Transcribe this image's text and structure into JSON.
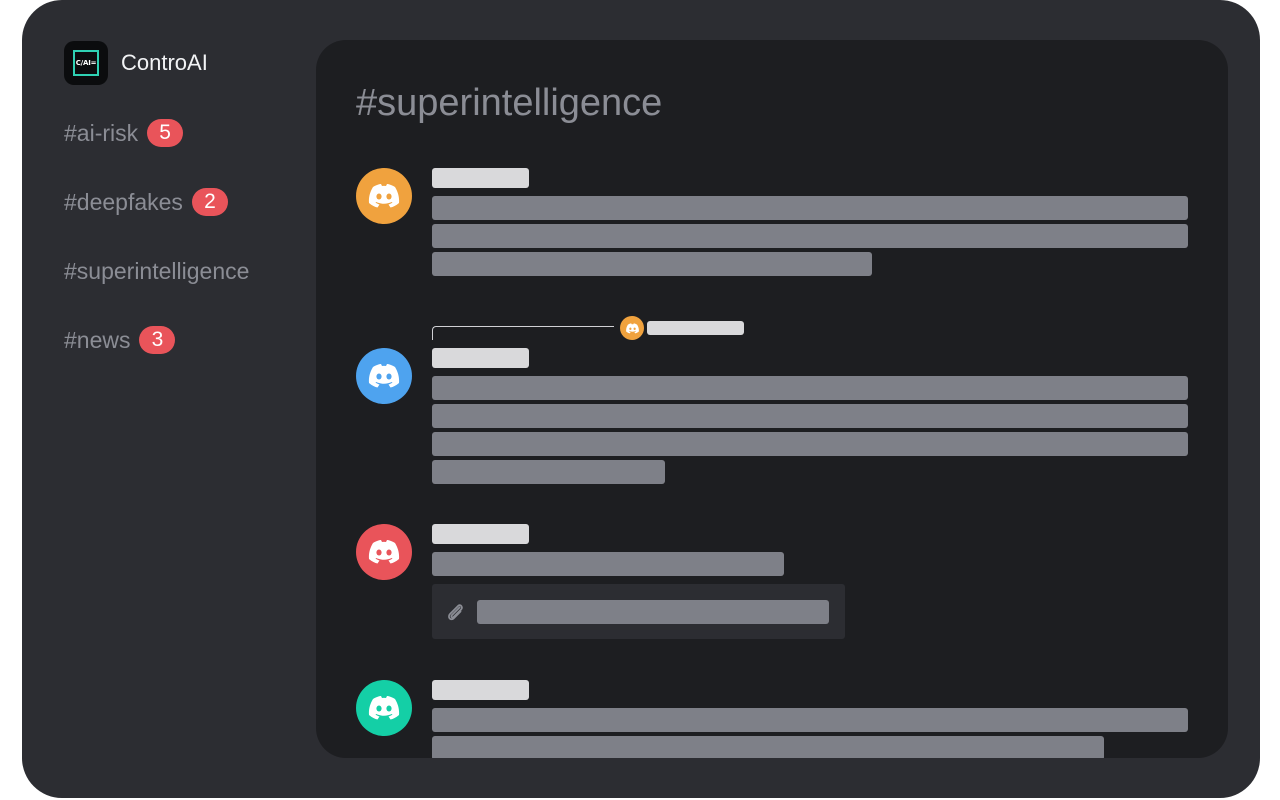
{
  "brand": {
    "name": "ControAI",
    "logo_text": "C/AI=",
    "accent_color": "#2fd1b4"
  },
  "channels": [
    {
      "label": "#ai-risk",
      "badge": "5"
    },
    {
      "label": "#deepfakes",
      "badge": "2"
    },
    {
      "label": "#superintelligence",
      "badge": null
    },
    {
      "label": "#news",
      "badge": "3"
    }
  ],
  "main": {
    "title": "#superintelligence"
  },
  "messages": [
    {
      "avatar_icon": "discord-icon",
      "avatar_color": "#f0a23e"
    },
    {
      "avatar_icon": "discord-icon",
      "avatar_color": "#4ea3ef",
      "reply_to_avatar_color": "#f0a23e"
    },
    {
      "avatar_icon": "discord-icon",
      "avatar_color": "#e9545a",
      "attachment_icon": "paperclip-icon"
    },
    {
      "avatar_icon": "discord-icon",
      "avatar_color": "#14cfa6"
    }
  ],
  "colors": {
    "badge": "#e9545a",
    "frame": "#2c2d32",
    "panel": "#1d1e21"
  }
}
